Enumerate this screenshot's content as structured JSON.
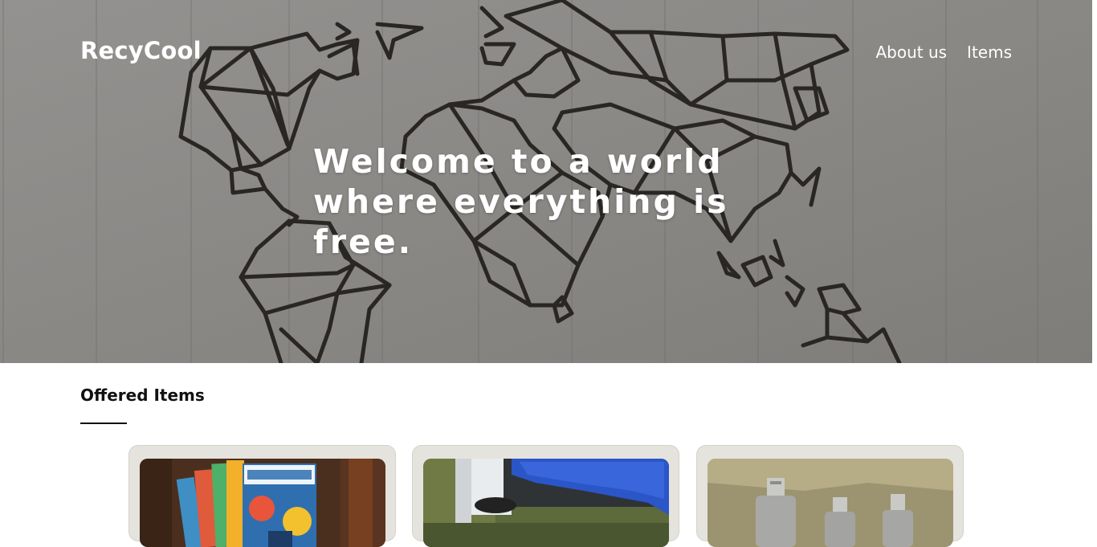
{
  "header": {
    "brand": "RecyCool",
    "nav": [
      {
        "label": "About us"
      },
      {
        "label": "Items"
      }
    ]
  },
  "hero": {
    "title": "Welcome to a world where everything is free."
  },
  "offered": {
    "title": "Offered Items",
    "items": [
      {
        "image": "cross-stitcher-magazines"
      },
      {
        "image": "blue-bucket-seat"
      },
      {
        "image": "metal-bottles"
      }
    ]
  },
  "colors": {
    "hero_background": "#8c8a87",
    "map_lines": "#2a2624",
    "card_background": "#e5e3dd",
    "text": "#111111",
    "header_text": "#ffffff"
  }
}
